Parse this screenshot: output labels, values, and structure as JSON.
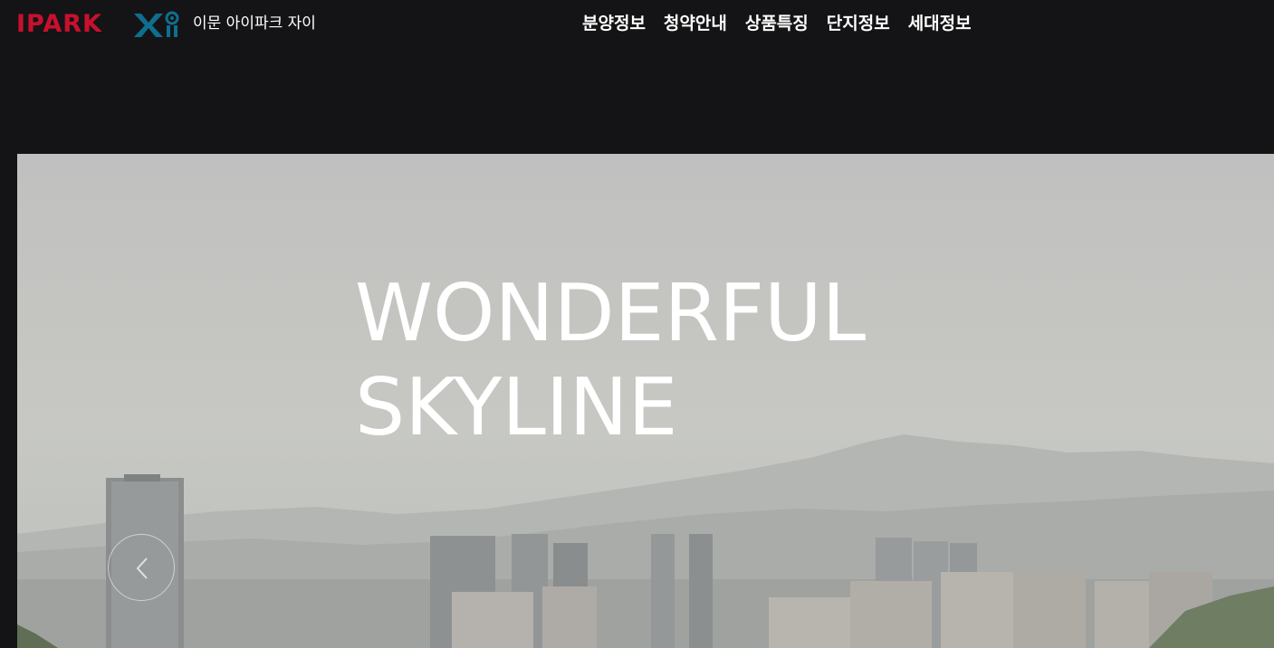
{
  "header": {
    "brand_ipark": "IPARK",
    "site_name": "이문 아이파크 자이",
    "nav": [
      {
        "label": "분양정보"
      },
      {
        "label": "청약안내"
      },
      {
        "label": "상품특징"
      },
      {
        "label": "단지정보"
      },
      {
        "label": "세대정보"
      }
    ]
  },
  "hero": {
    "headline_line1": "WONDERFUL",
    "headline_line2": "SKYLINE",
    "prev_icon": "chevron-left-icon"
  },
  "colors": {
    "background": "#141416",
    "ipark_red": "#c8102e",
    "xi_teal": "#0e6f8f",
    "text": "#ffffff"
  }
}
